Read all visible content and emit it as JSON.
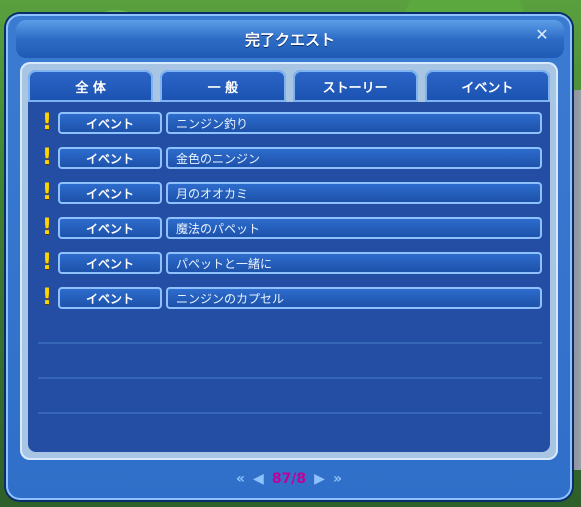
{
  "window": {
    "title": "完了クエスト"
  },
  "tabs": [
    {
      "label": "全 体"
    },
    {
      "label": "一 般"
    },
    {
      "label": "ストーリー"
    },
    {
      "label": "イベント"
    }
  ],
  "quests": [
    {
      "category": "イベント",
      "name": "ニンジン釣り"
    },
    {
      "category": "イベント",
      "name": "金色のニンジン"
    },
    {
      "category": "イベント",
      "name": "月のオオカミ"
    },
    {
      "category": "イベント",
      "name": "魔法のパペット"
    },
    {
      "category": "イベント",
      "name": "パペットと一緒に"
    },
    {
      "category": "イベント",
      "name": "ニンジンのカプセル"
    }
  ],
  "pagination": {
    "first_icon": "double-left-arrow",
    "prev_icon": "left-arrow",
    "next_icon": "right-arrow",
    "last_icon": "double-right-arrow",
    "page_text": "87/8"
  },
  "colors": {
    "accent": "#2f6fd1",
    "highlight": "#ffd400",
    "page_number": "#c00098"
  }
}
